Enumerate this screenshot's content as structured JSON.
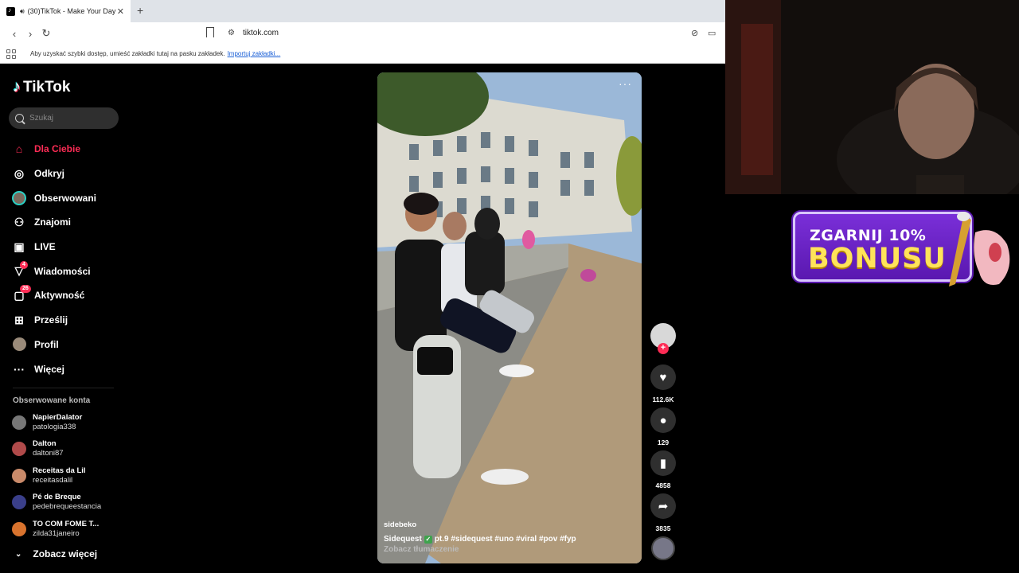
{
  "browser": {
    "tab_title": "(30)TikTok - Make Your Day",
    "url": "tiktok.com",
    "bookmarks_hint": "Aby uzyskać szybki dostęp, umieść zakładki tutaj na pasku zakładek.",
    "bookmarks_import": "Importuj zakładki..."
  },
  "tiktok": {
    "logo": "TikTok",
    "search_placeholder": "Szukaj",
    "nav": [
      {
        "label": "Dla Ciebie",
        "icon": "home-icon",
        "active": true
      },
      {
        "label": "Odkryj",
        "icon": "compass-icon"
      },
      {
        "label": "Obserwowani",
        "icon": "avatar-icon"
      },
      {
        "label": "Znajomi",
        "icon": "friends-icon"
      },
      {
        "label": "LIVE",
        "icon": "live-icon"
      },
      {
        "label": "Wiadomości",
        "icon": "messages-icon",
        "badge": "4"
      },
      {
        "label": "Aktywność",
        "icon": "activity-icon",
        "badge": "26"
      },
      {
        "label": "Prześlij",
        "icon": "upload-icon"
      },
      {
        "label": "Profil",
        "icon": "profile-icon"
      },
      {
        "label": "Więcej",
        "icon": "more-icon"
      }
    ],
    "followed_heading": "Obserwowane konta",
    "followed": [
      {
        "name": "NapierDalator",
        "handle": "patologia338"
      },
      {
        "name": "Dalton",
        "handle": "daltoni87"
      },
      {
        "name": "Receitas da Lil",
        "handle": "receitasdalil"
      },
      {
        "name": "Pé de Breque",
        "handle": "pedebrequeestancia"
      },
      {
        "name": "TO COM FOME T...",
        "handle": "zilda31janeiro"
      }
    ],
    "see_more": "Zobacz więcej",
    "video": {
      "username": "sidebeko",
      "desc_before": "Sidequest",
      "desc_after": "pt.9 #sidequest #uno #viral #pov #fyp",
      "translate": "Zobacz tłumaczenie"
    },
    "actions": {
      "likes": "112.6K",
      "comments": "129",
      "saves": "4858",
      "shares": "3835"
    }
  },
  "promo": {
    "line1": "ZGARNIJ 10%",
    "line2": "BONUSU"
  },
  "colors": {
    "accent": "#fe2c55",
    "promo_bg": "#6a22c8",
    "promo_text": "#ffe35a"
  }
}
